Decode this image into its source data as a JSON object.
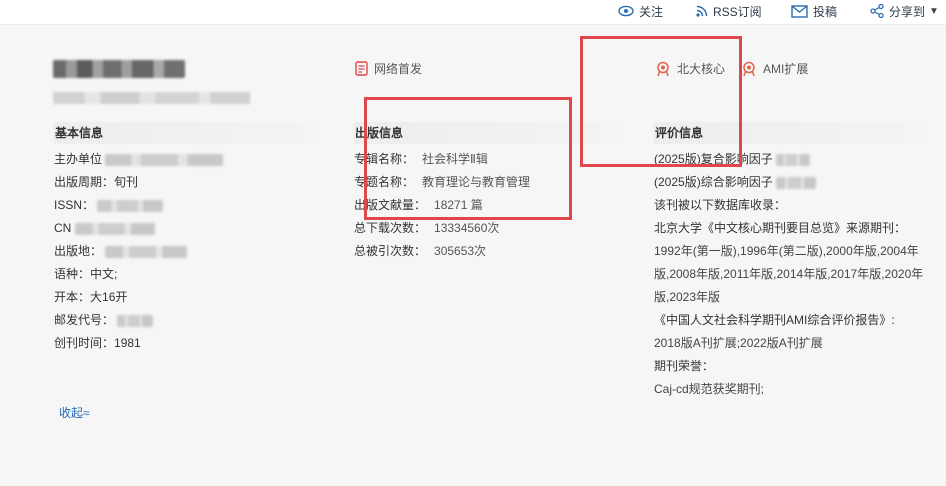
{
  "topbar": {
    "follow": "关注",
    "rss": "RSS订阅",
    "submit": "投稿",
    "share": "分享到"
  },
  "badges": {
    "first_online": "网络首发",
    "pku_core": "北大核心",
    "ami_ext": "AMI扩展"
  },
  "basic": {
    "heading": "基本信息",
    "sponsor_label": "主办单位",
    "cycle_label": "出版周期：",
    "cycle_value": "旬刊",
    "issn_label": "ISSN：",
    "cn_label": "CN",
    "place_label": "出版地：",
    "lang_label": "语种：",
    "lang_value": "中文;",
    "format_label": "开本：",
    "format_value": "大16开",
    "postal_label": "邮发代号：",
    "founded_label": "创刊时间：",
    "founded_value": "1981"
  },
  "publication": {
    "heading": "出版信息",
    "series_label": "专辑名称：",
    "series_value": "社会科学Ⅱ辑",
    "topic_label": "专题名称：",
    "topic_value": "教育理论与教育管理",
    "count_label": "出版文献量：",
    "count_value": "18271 篇",
    "downloads_label": "总下载次数：",
    "downloads_value": "13334560次",
    "citations_label": "总被引次数：",
    "citations_value": "305653次"
  },
  "evaluation": {
    "heading": "评价信息",
    "composite_if": "(2025版)复合影响因子",
    "comprehensive_if": "(2025版)综合影响因子",
    "db_intro": "该刊被以下数据库收录：",
    "pku_source": "北京大学《中文核心期刊要目总览》来源期刊：",
    "pku_years": "1992年(第一版),1996年(第二版),2000年版,2004年版,2008年版,2011年版,2014年版,2017年版,2020年版,2023年版",
    "ami_report": "《中国人文社会科学期刊AMI综合评价报告》:",
    "ami_years": "2018版A刊扩展;2022版A刊扩展",
    "honors_label": "期刊荣誉：",
    "honors_value": "Caj-cd规范获奖期刊;"
  },
  "collapse_label": "收起≈"
}
